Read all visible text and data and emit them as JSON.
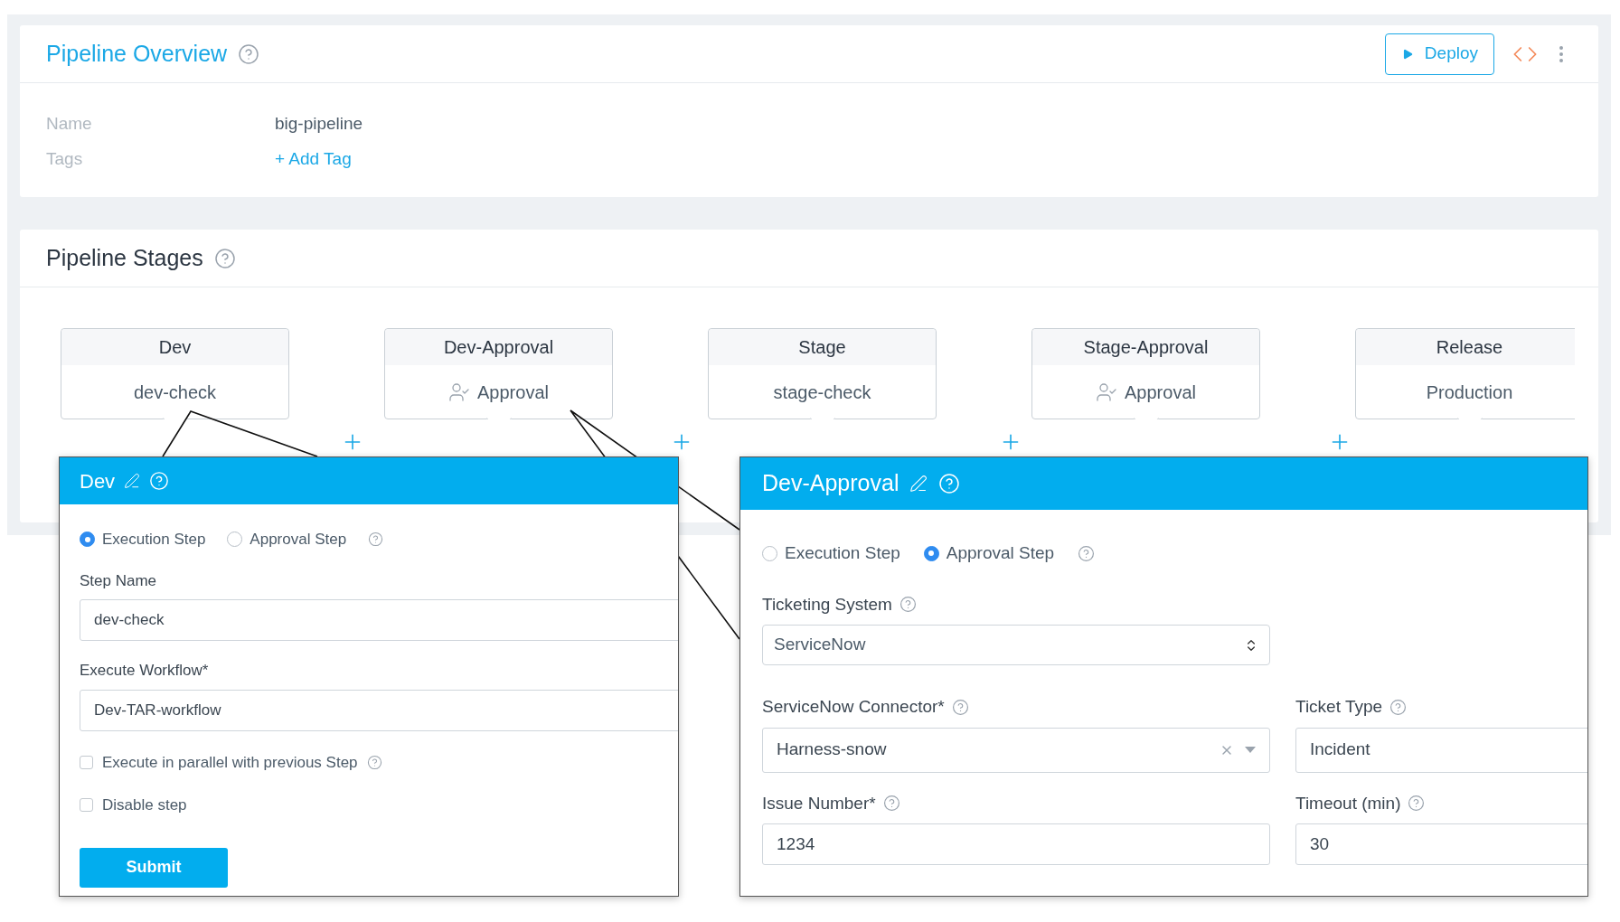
{
  "overview": {
    "title": "Pipeline Overview",
    "deploy": "Deploy",
    "fields": [
      {
        "label": "Name",
        "value": "big-pipeline",
        "kind": "text"
      },
      {
        "label": "Tags",
        "value": "+ Add Tag",
        "kind": "link"
      }
    ]
  },
  "stages": {
    "title": "Pipeline Stages",
    "items": [
      {
        "name": "Dev",
        "step": "dev-check",
        "kind": "execution"
      },
      {
        "name": "Dev-Approval",
        "step": "Approval",
        "kind": "approval"
      },
      {
        "name": "Stage",
        "step": "stage-check",
        "kind": "execution"
      },
      {
        "name": "Stage-Approval",
        "step": "Approval",
        "kind": "approval"
      },
      {
        "name": "Release",
        "step": "Production",
        "kind": "execution"
      }
    ]
  },
  "dev_panel": {
    "title": "Dev",
    "step_types": [
      {
        "label": "Execution Step",
        "selected": true
      },
      {
        "label": "Approval Step",
        "selected": false
      }
    ],
    "fields": [
      {
        "label": "Step Name",
        "value": "dev-check"
      },
      {
        "label": "Execute Workflow*",
        "value": "Dev-TAR-workflow"
      }
    ],
    "options": [
      {
        "label": "Execute in parallel with previous Step",
        "checked": false,
        "help": true
      },
      {
        "label": "Disable step",
        "checked": false,
        "help": false
      }
    ],
    "submit": "Submit"
  },
  "approval_panel": {
    "title": "Dev-Approval",
    "step_types": [
      {
        "label": "Execution Step",
        "selected": false
      },
      {
        "label": "Approval Step",
        "selected": true
      }
    ],
    "ticketing_system": {
      "label": "Ticketing System",
      "value": "ServiceNow"
    },
    "rows": [
      [
        {
          "label": "ServiceNow Connector*",
          "value": "Harness-snow",
          "kind": "combo"
        },
        {
          "label": "Ticket Type",
          "value": "Incident",
          "kind": "text"
        }
      ],
      [
        {
          "label": "Issue Number*",
          "value": "1234",
          "kind": "text"
        },
        {
          "label": "Timeout (min)",
          "value": "30",
          "kind": "text"
        }
      ]
    ]
  }
}
